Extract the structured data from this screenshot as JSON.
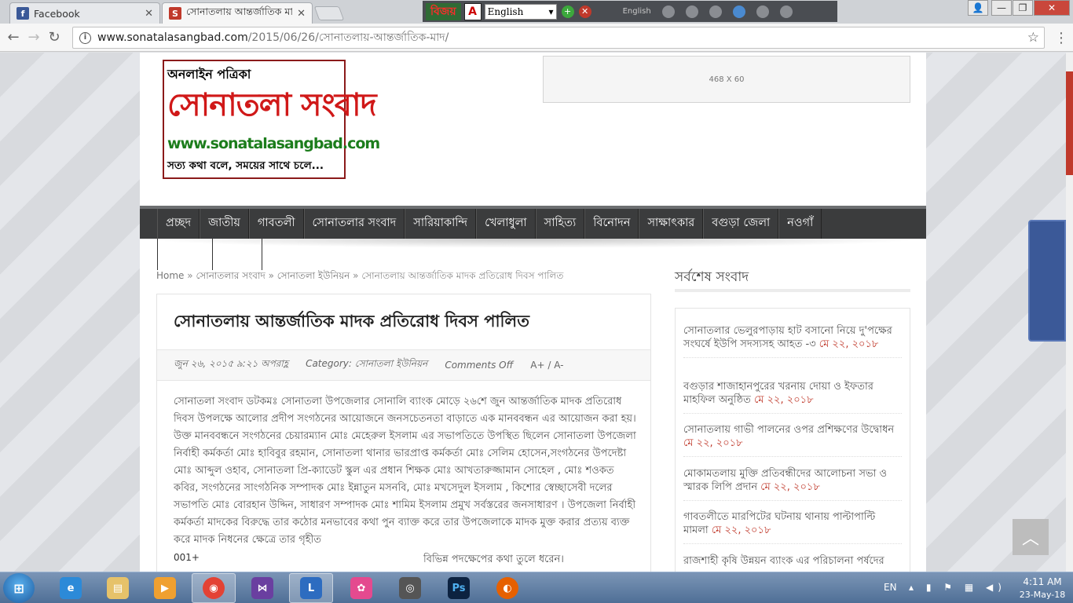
{
  "browser": {
    "tabs": [
      {
        "title": "Facebook",
        "favicon": "f",
        "favicon_color": "#3b5998"
      },
      {
        "title": "সোনাতলায় আন্তর্জাতিক মা",
        "favicon": "S",
        "favicon_color": "#c0392b"
      }
    ],
    "bijoy": {
      "logo": "বিজয়",
      "language": "English",
      "mode_label": "English"
    },
    "url": {
      "host": "www.sonatalasangbad.com",
      "path": "/2015/06/26/সোনাতলায়-আন্তর্জাতিক-মাদ/"
    },
    "controls": {
      "minimize": "—",
      "maximize": "❐",
      "close": "✕"
    }
  },
  "site": {
    "logo": {
      "tagline_top": "অনলাইন পত্রিকা",
      "name": "সোনাতলা সংবাদ",
      "domain": "www.sonatalasangbad.com",
      "slogan": "সত্য কথা বলে, সময়ের সাথে চলে..."
    },
    "ad_label": "468 X 60",
    "menu": [
      "প্রচ্ছদ",
      "জাতীয়",
      "গাবতলী",
      "সোনাতলার সংবাদ",
      "সারিয়াকান্দি",
      "খেলাধুলা",
      "সাহিত্য",
      "বিনোদন",
      "সাক্ষাৎকার",
      "বগুড়া জেলা",
      "নওগাঁ"
    ],
    "breadcrumb": {
      "home": "Home",
      "sep": "»",
      "level1": "সোনাতলার সংবাদ",
      "level2": "সোনাতলা ইউনিয়ন",
      "current": "সোনাতলায় আন্তর্জাতিক মাদক প্রতিরোধ দিবস পালিত"
    },
    "article": {
      "title": "সোনাতলায় আন্তর্জাতিক মাদক প্রতিরোধ দিবস পালিত",
      "date": "জুন ২৬, ২০১৫ ৯:২১ অপরাহ্ণ",
      "category": "Category: সোনাতলা ইউনিয়ন",
      "comments": "Comments Off",
      "font_size": "A+ / A-",
      "body": "সোনাতলা সংবাদ ডটকমঃ সোনাতলা উপজেলার সোনালি ব্যাংক মোড়ে ২৬শে জুন আন্তর্জাতিক মাদক প্রতিরোধ দিবস উপলক্ষে আলোর প্রদীপ সংগঠনের আয়োজনে  জনসচেতনতা বাড়াতে এক মানববন্ধন এর আয়োজন করা হয়। উক্ত মানববন্ধনে সংগঠনের চেয়ারম্যান মোঃ মেহেরুল ইসলাম এর সভাপতিতে উপস্থিত ছিলেন সোনাতলা উপজেলা নির্বাহী কর্মকর্তা মোঃ হাবিবুর রহমান, সোনাতলা থানার ভারপ্রাপ্ত কর্মকর্তা মোঃ সেলিম হোসেন,সংগঠনের উপদেষ্টা মোঃ আব্দুল ওহাব, সোনাতলা প্রি-ক্যাডেট স্কুল এর প্রধান শিক্ষক মোঃ আখতারুজ্জামান সোহেল , মোঃ শওকত কবির, সংগঠনের সাংগঠনিক সম্পাদক মোঃ ইন্নাতুন মসনবি, মোঃ মখসেদুল ইসলাম , কিশোর স্বেচ্ছাসেবী দলের সভাপতি মোঃ বোরহান উদ্দিন, সাধারণ সম্পাদক মোঃ শামিম ইসলাম প্রমুখ সর্বস্তরের জনসাধারণ । উপজেলা নির্বাহী কর্মকর্তা মাদকের বিরুদ্ধে তার কঠোর মনভাবের কথা পুন ব্যাক্ত করে তার উপজেলাকে মাদক মুক্ত করার প্রত্যয় ব্যক্ত করে মাদক নিধনের ক্ষেত্রে তার গৃহীত",
      "image_alt": "001+",
      "body_tail": "বিভিন্ন পদক্ষেপের কথা তুলে ধরেন।"
    },
    "sidebar": {
      "title": "সর্বশেষ সংবাদ",
      "items": [
        {
          "text": "সোনাতলার ভেলুরপাড়ায় হাট বসানো নিয়ে দু'পক্ষের সংঘর্ষে ইউপি সদস্যসহ আহত -৩",
          "date": "মে ২২, ২০১৮"
        },
        {
          "text": "বগুড়ার শাজাহানপুরের খরনায় দোয়া ও ইফতার মাহফিল অনুষ্ঠিত",
          "date": "মে ২২, ২০১৮"
        },
        {
          "text": "সোনাতলায় গাভী পালনের ওপর প্রশিক্ষণের উদ্বোধন",
          "date": "মে ২২, ২০১৮"
        },
        {
          "text": "মোকামতলায় মুক্তি প্রতিবন্ধীদের আলোচনা সভা ও স্মারক লিপি প্রদান",
          "date": "মে ২২, ২০১৮"
        },
        {
          "text": "গাবতলীতে মারপিটের ঘটনায় থানায় পাল্টাপাল্টি মামলা",
          "date": "মে ২২, ২০১৮"
        },
        {
          "text": "রাজশাহী কৃষি উন্নয়ন ব্যাংক এর পরিচালনা পর্ষদের",
          "date": ""
        }
      ]
    },
    "facebook_tab": "facebook"
  },
  "taskbar": {
    "language": "EN",
    "time": "4:11 AM",
    "date": "23-May-18"
  }
}
